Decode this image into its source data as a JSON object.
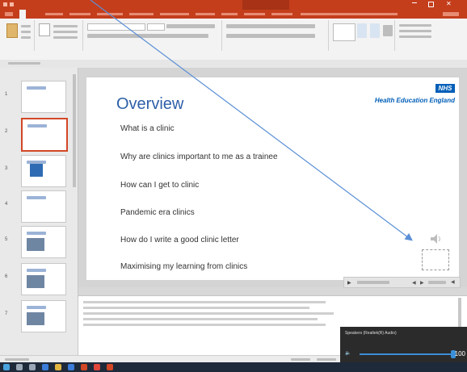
{
  "colors": {
    "accent": "#c43e1c",
    "title_blue": "#2e5fa8",
    "nhs_blue": "#005eb8",
    "arrow": "#5a8fd6"
  },
  "slide": {
    "title": "Overview",
    "logo_text": "NHS",
    "org_name": "Health Education England",
    "bullets": [
      "What is a clinic",
      "Why are clinics important to me as a trainee",
      "How can I get to clinic",
      "Pandemic era clinics",
      "How do I write a good clinic letter",
      "Maximising my learning from clinics"
    ]
  },
  "thumbnails": [
    {
      "number": "1",
      "selected": false
    },
    {
      "number": "2",
      "selected": true
    },
    {
      "number": "3",
      "selected": false
    },
    {
      "number": "4",
      "selected": false
    },
    {
      "number": "5",
      "selected": false
    },
    {
      "number": "6",
      "selected": false
    },
    {
      "number": "7",
      "selected": false
    }
  ],
  "popup": {
    "label": "Speakers (Realtek(R) Audio)",
    "min_label": "",
    "max_label": "100",
    "level_fraction": 0.98
  },
  "icons": [
    "speaker-icon",
    "arrow-annotation"
  ]
}
